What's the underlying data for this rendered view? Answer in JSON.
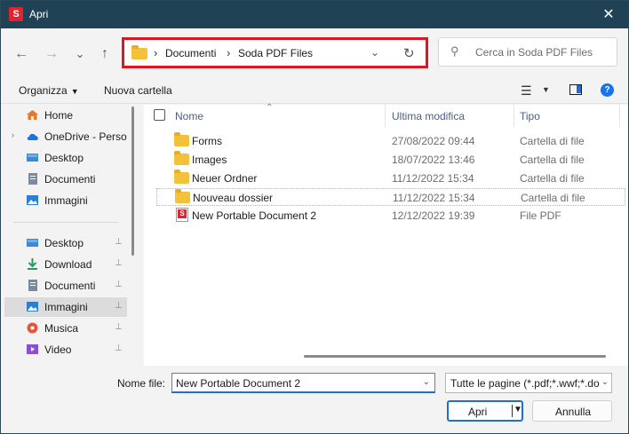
{
  "window": {
    "title": "Apri",
    "close": "✕"
  },
  "nav": {
    "back": "←",
    "forward": "→",
    "recent": "⌄",
    "up": "↑"
  },
  "address": {
    "sep1": "›",
    "crumb1": "Documenti",
    "sep2": "›",
    "crumb2": "Soda PDF Files",
    "dropdown": "⌄",
    "refresh": "↻"
  },
  "search": {
    "placeholder": "Cerca in Soda PDF Files"
  },
  "toolbar": {
    "organize": "Organizza",
    "organize_caret": "▼",
    "new_folder": "Nuova cartella",
    "view_caret": "▼",
    "help": "?"
  },
  "sidebar": {
    "items": [
      {
        "label": "Home",
        "icon": "home-icon",
        "color": "#e07a2f"
      },
      {
        "label": "OneDrive - Perso",
        "icon": "cloud-icon",
        "color": "#1a73e8"
      },
      {
        "label": "Desktop",
        "icon": "desktop-icon",
        "color": "#3a8ad8"
      },
      {
        "label": "Documenti",
        "icon": "document-icon",
        "color": "#7b8aa0"
      },
      {
        "label": "Immagini",
        "icon": "image-icon",
        "color": "#2c7fd1"
      },
      {
        "label": "Desktop",
        "icon": "desktop-icon",
        "color": "#3a8ad8"
      },
      {
        "label": "Download",
        "icon": "download-icon",
        "color": "#2a9a5a"
      },
      {
        "label": "Documenti",
        "icon": "document-icon",
        "color": "#7b8aa0"
      },
      {
        "label": "Immagini",
        "icon": "image-icon",
        "color": "#2c7fd1"
      },
      {
        "label": "Musica",
        "icon": "music-icon",
        "color": "#e0593a"
      },
      {
        "label": "Video",
        "icon": "video-icon",
        "color": "#8b4fd1"
      }
    ],
    "pin": "📌"
  },
  "columns": {
    "name": "Nome",
    "modified": "Ultima modifica",
    "type": "Tipo"
  },
  "files": [
    {
      "name": "Forms",
      "date": "27/08/2022 09:44",
      "type": "Cartella di file",
      "icon": "folder-icon"
    },
    {
      "name": "Images",
      "date": "18/07/2022 13:46",
      "type": "Cartella di file",
      "icon": "folder-icon"
    },
    {
      "name": "Neuer Ordner",
      "date": "11/12/2022 15:34",
      "type": "Cartella di file",
      "icon": "folder-icon"
    },
    {
      "name": "Nouveau dossier",
      "date": "11/12/2022 15:34",
      "type": "Cartella di file",
      "icon": "folder-icon"
    },
    {
      "name": "New Portable Document 2",
      "date": "12/12/2022 19:39",
      "type": "File PDF",
      "icon": "pdf-file-icon"
    }
  ],
  "bottom": {
    "filename_label": "Nome file:",
    "filename_value": "New Portable Document 2",
    "filter_value": "Tutte le pagine (*.pdf;*.wwf;*.do",
    "open_label": "Apri",
    "cancel_label": "Annulla",
    "dropdown": "⌄",
    "open_dropdown": "▼"
  }
}
